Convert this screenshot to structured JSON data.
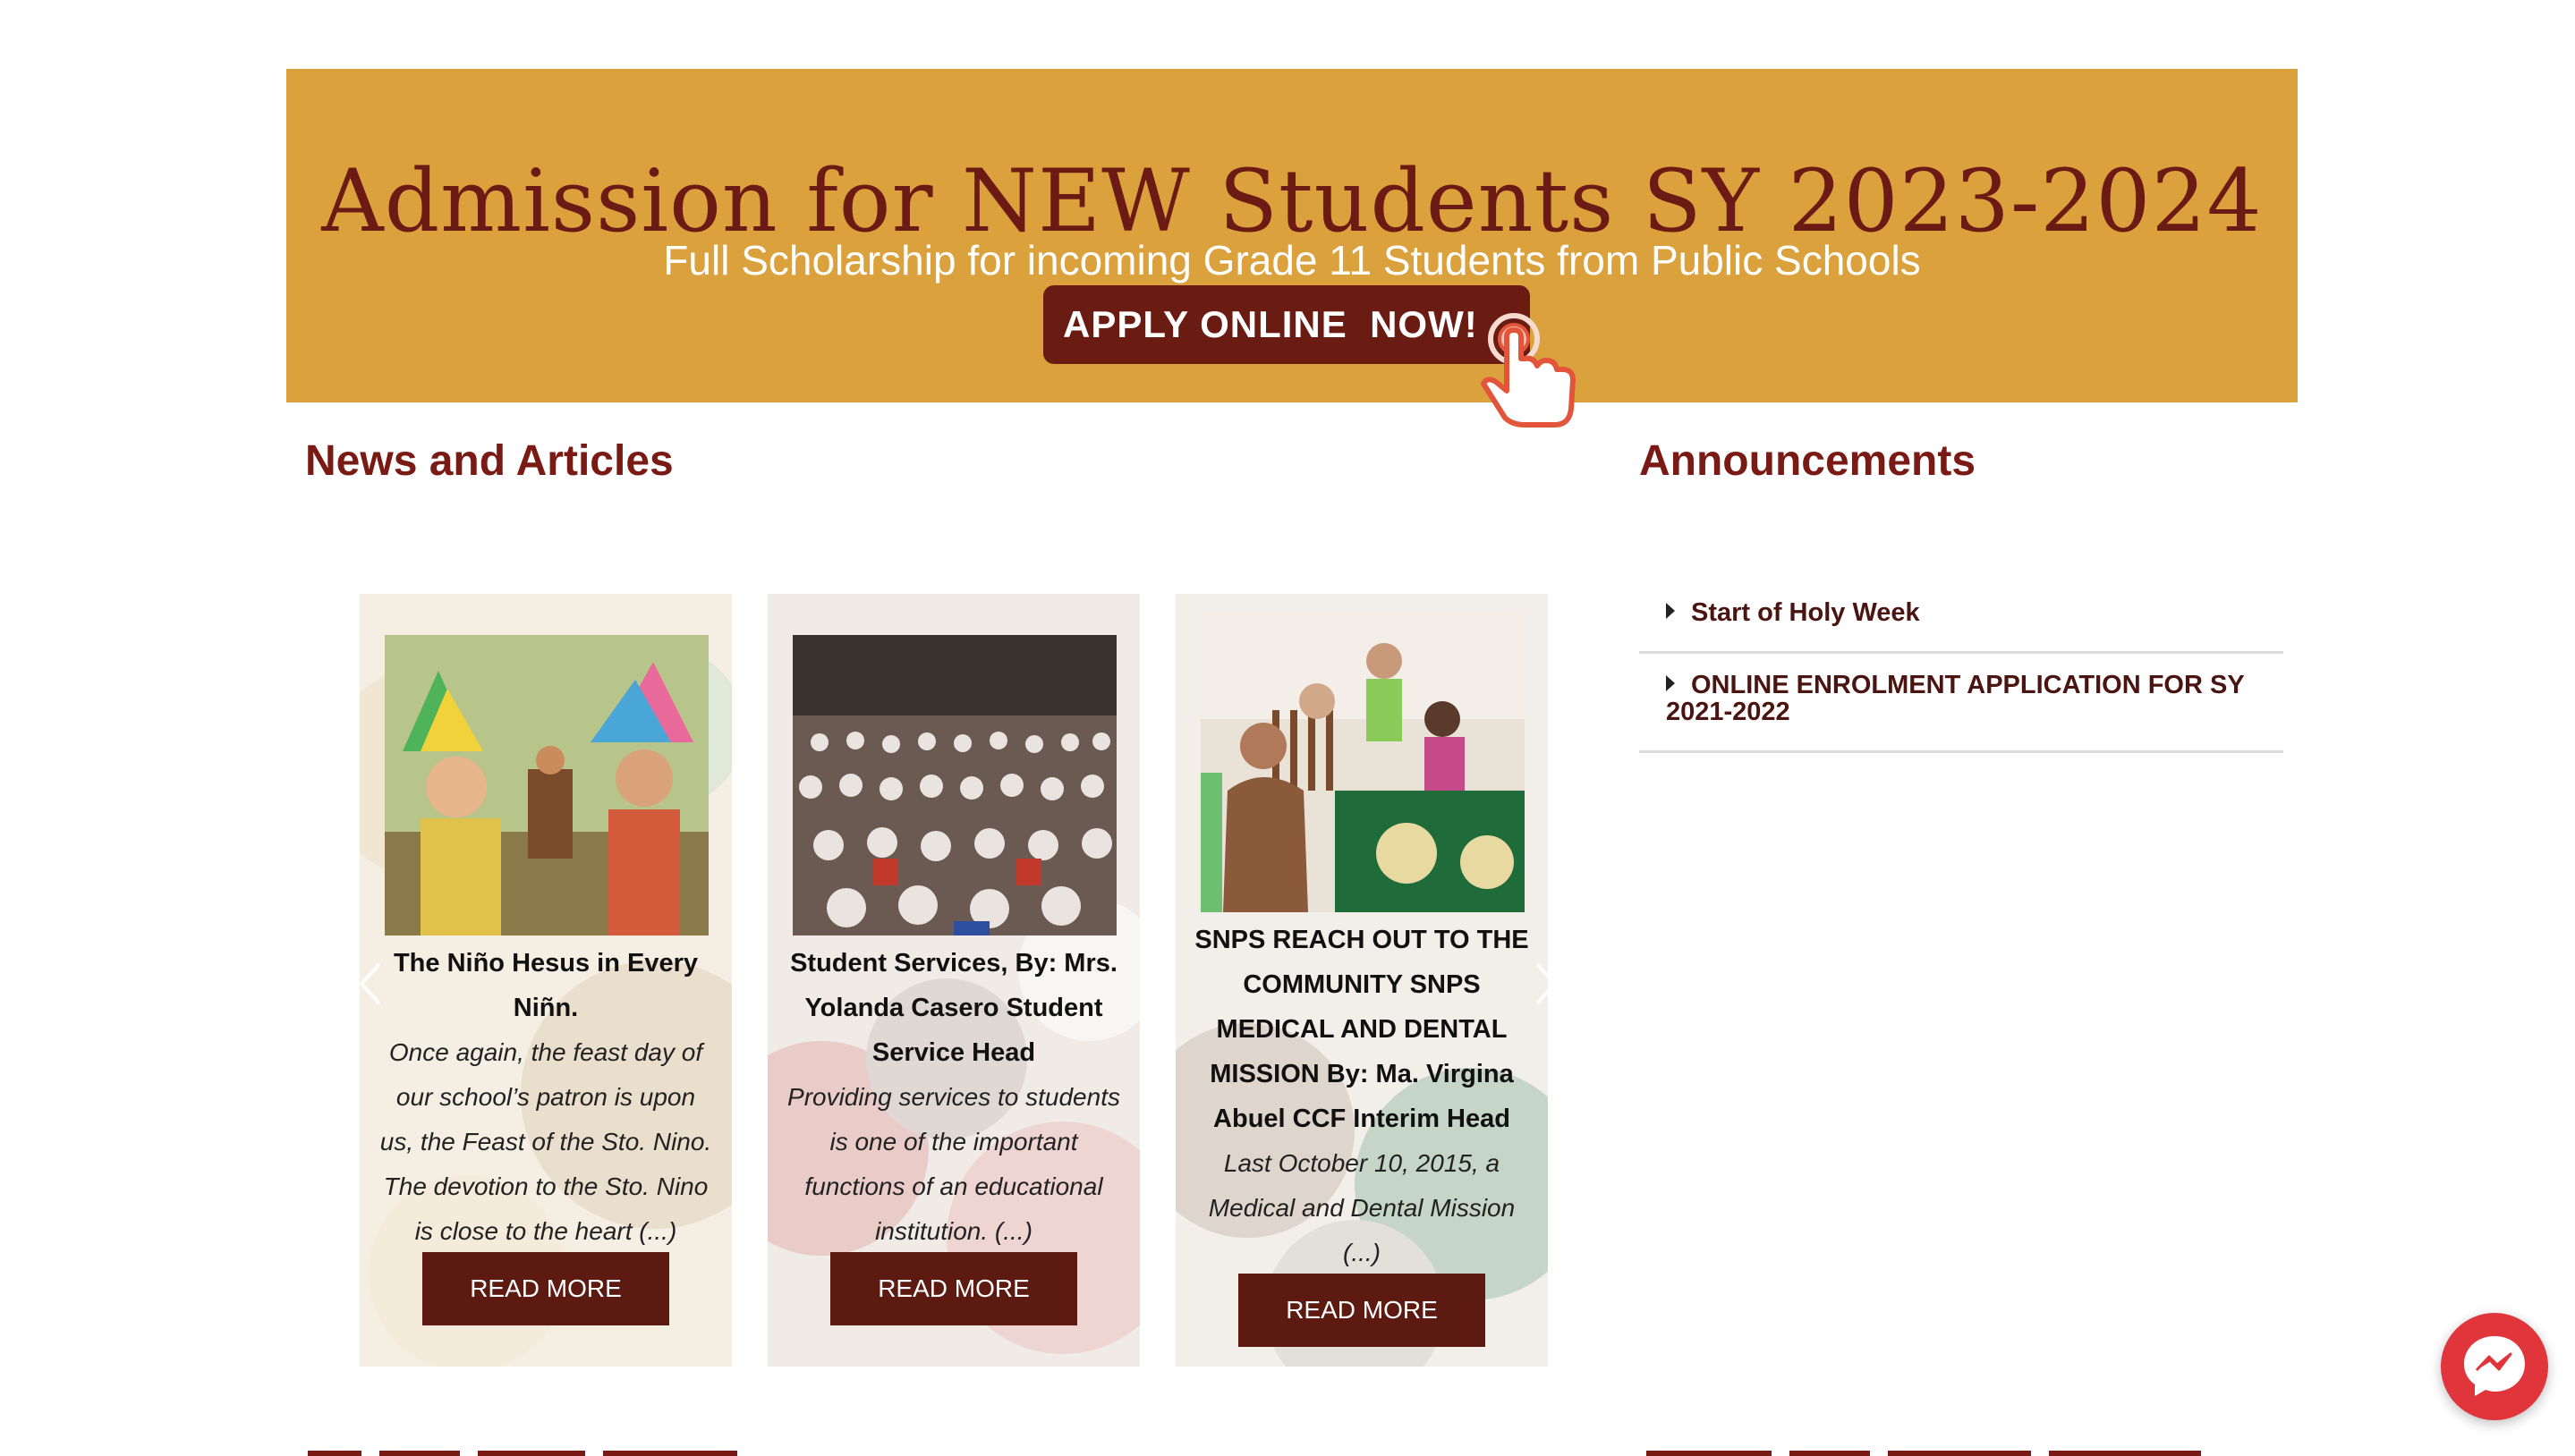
{
  "banner": {
    "title": "Admission for NEW Students SY 2023-2024",
    "subtitle": "Full Scholarship for incoming Grade 11 Students from Public Schools",
    "apply_label": "APPLY ONLINE  NOW!",
    "colors": {
      "background": "#dba13d",
      "title": "#6b1a14",
      "button": "#6a1b12"
    }
  },
  "news": {
    "heading": "News and Articles",
    "read_more_label": "READ MORE",
    "cards": [
      {
        "title": "The Niño Hesus in Every Niñn.",
        "excerpt": "Once again, the feast day of our school’s patron is upon us, the Feast of the Sto. Nino. The devotion to the Sto. Nino is close to the heart (...)",
        "read_more": "READ MORE"
      },
      {
        "title": "Student Services, By: Mrs. Yolanda Casero Student Service Head",
        "excerpt": "Providing services to students is one of the important functions of an educational institution. (...)",
        "read_more": "READ MORE"
      },
      {
        "title": "SNPS REACH OUT TO THE COMMUNITY SNPS MEDICAL AND DENTAL MISSION By: Ma. Virgina Abuel CCF Interim Head",
        "excerpt": "Last October 10, 2015, a Medical and Dental Mission (...)",
        "read_more": "READ MORE"
      }
    ]
  },
  "announcements": {
    "heading": "Announcements",
    "items": [
      {
        "label": "Start of Holy Week"
      },
      {
        "label": "ONLINE ENROLMENT APPLICATION FOR SY 2021-2022"
      }
    ]
  },
  "icons": {
    "apply": "hand-pointer-icon",
    "caret": "caret-right-icon",
    "prev": "chevron-left-icon",
    "next": "chevron-right-icon",
    "chat": "messenger-icon"
  },
  "theme": {
    "accent": "#7a1a14",
    "button": "#5c1a10"
  }
}
